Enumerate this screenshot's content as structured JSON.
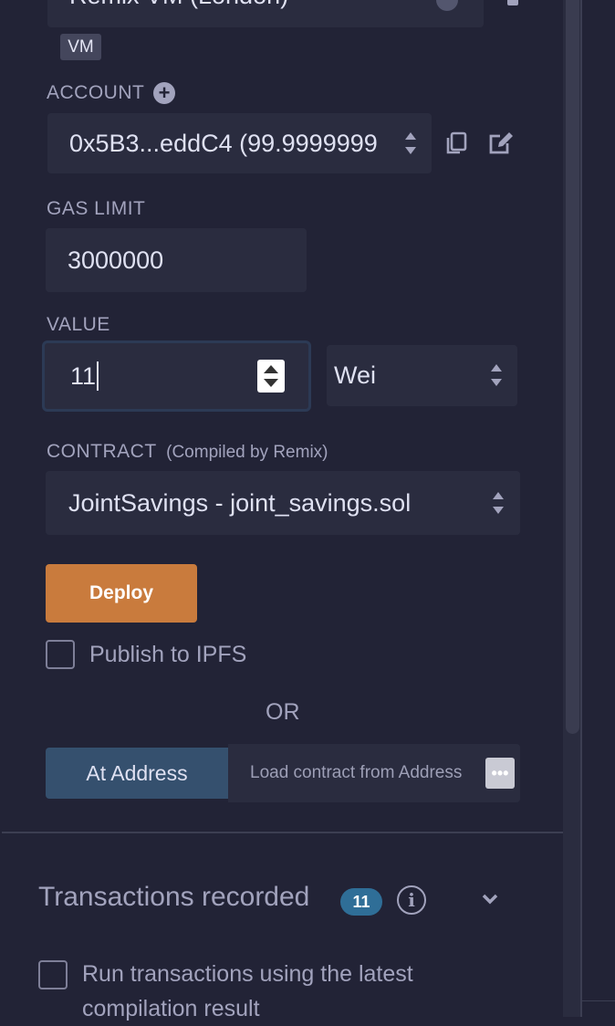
{
  "environment": {
    "value": "Remix VM (London)",
    "badge": "VM"
  },
  "account": {
    "label": "ACCOUNT",
    "value": "0x5B3...eddC4 (99.9999999"
  },
  "gas_limit": {
    "label": "GAS LIMIT",
    "value": "3000000"
  },
  "value_field": {
    "label": "VALUE",
    "value": "11",
    "unit": "Wei"
  },
  "contract": {
    "label": "CONTRACT",
    "sublabel": "(Compiled by Remix)",
    "value": "JointSavings - joint_savings.sol"
  },
  "deploy": {
    "label": "Deploy"
  },
  "publish": {
    "label": "Publish to IPFS"
  },
  "or_text": "OR",
  "at_address": {
    "button_label": "At Address",
    "placeholder": "Load contract from Address"
  },
  "transactions": {
    "title": "Transactions recorded",
    "count": "11"
  },
  "run_latest": {
    "line1": "Run transactions using the latest",
    "line2": "compilation result"
  },
  "colors": {
    "background": "#222336",
    "field": "#2a2c3f",
    "deploy": "#c97b3d",
    "at_address": "#35506e",
    "badge": "#2f6e97"
  }
}
